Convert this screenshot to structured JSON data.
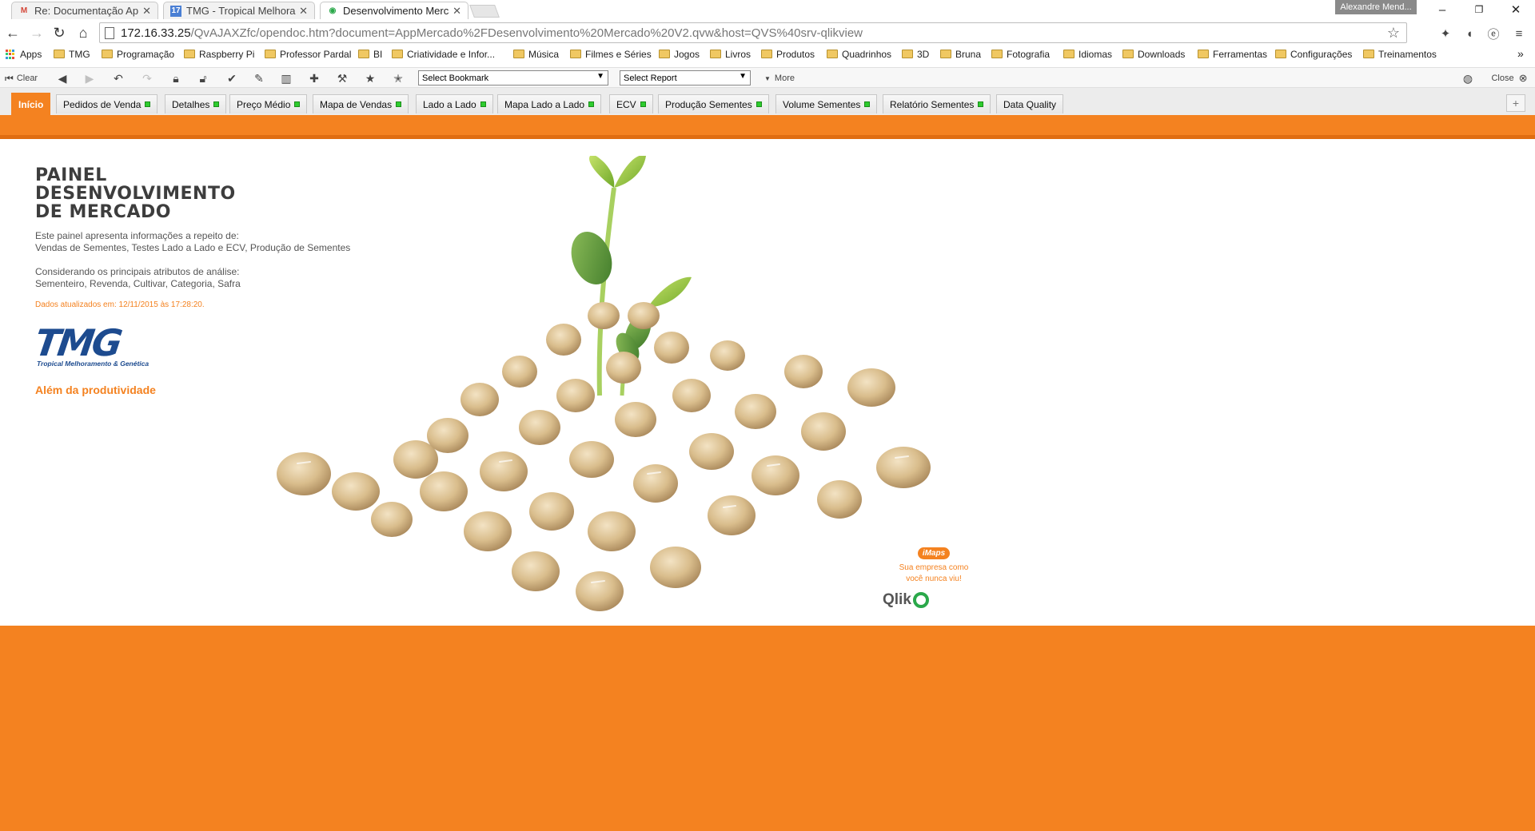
{
  "browser": {
    "tabs": [
      {
        "title": "Re: Documentação Aplica",
        "icon": "gmail-icon",
        "active": false
      },
      {
        "title": "TMG - Tropical Melhoram",
        "icon": "calendar-icon",
        "active": false
      },
      {
        "title": "Desenvolvimento Mercado",
        "icon": "qlikview-icon",
        "active": true
      }
    ],
    "user": "Alexandre Mend...",
    "url_host": "172.16.33.25",
    "url_path": "/QvAJAXZfc/opendoc.htm?document=AppMercado%2FDesenvolvimento%20Mercado%20V2.qvw&host=QVS%40srv-qlikview",
    "bookmarks": [
      "Apps",
      "TMG",
      "Programação",
      "Raspberry Pi",
      "Professor Pardal",
      "BI",
      "Criatividade e Infor...",
      "Música",
      "Filmes e Séries",
      "Jogos",
      "Livros",
      "Produtos",
      "Quadrinhos",
      "3D",
      "Bruna",
      "Fotografia",
      "Idiomas",
      "Downloads",
      "Ferramentas",
      "Configurações",
      "Treinamentos"
    ],
    "bookmarks_more": "»"
  },
  "toolbar": {
    "clear_label": "Clear",
    "bookmark_select": "Select Bookmark",
    "report_select": "Select Report",
    "more_label": "More",
    "close_label": "Close"
  },
  "sheets": {
    "tabs": [
      "Início",
      "Pedidos de Venda",
      "Detalhes",
      "Preço Médio",
      "Mapa de Vendas",
      "Lado a Lado",
      "Mapa Lado a Lado",
      "ECV",
      "Produção Sementes",
      "Volume Sementes",
      "Relatório Sementes",
      "Data Quality"
    ],
    "add": "+"
  },
  "page": {
    "title_lines": [
      "PAINEL",
      "DESENVOLVIMENTO",
      "DE MERCADO"
    ],
    "desc1_line1": "Este painel apresenta informações a repeito de:",
    "desc1_line2": "Vendas de Sementes, Testes Lado a Lado e ECV, Produção de Sementes",
    "desc2_line1": "Considerando os principais atributos de análise:",
    "desc2_line2": "Sementeiro, Revenda, Cultivar, Categoria, Safra",
    "updated": "Dados atualizados em: 12/11/2015 às 17:28:20.",
    "logo_text": "TMG",
    "logo_subtitle": "Tropical Melhoramento & Genética",
    "slogan": "Além da produtividade",
    "imaps_badge": "iMaps",
    "imaps_tag_line1": "Sua empresa como",
    "imaps_tag_line2": "você nunca viu!",
    "qlik_label": "Qlik"
  },
  "colors": {
    "accent": "#f48220",
    "tmg_blue": "#1d4b8f",
    "status_green": "#2ecc2e"
  }
}
